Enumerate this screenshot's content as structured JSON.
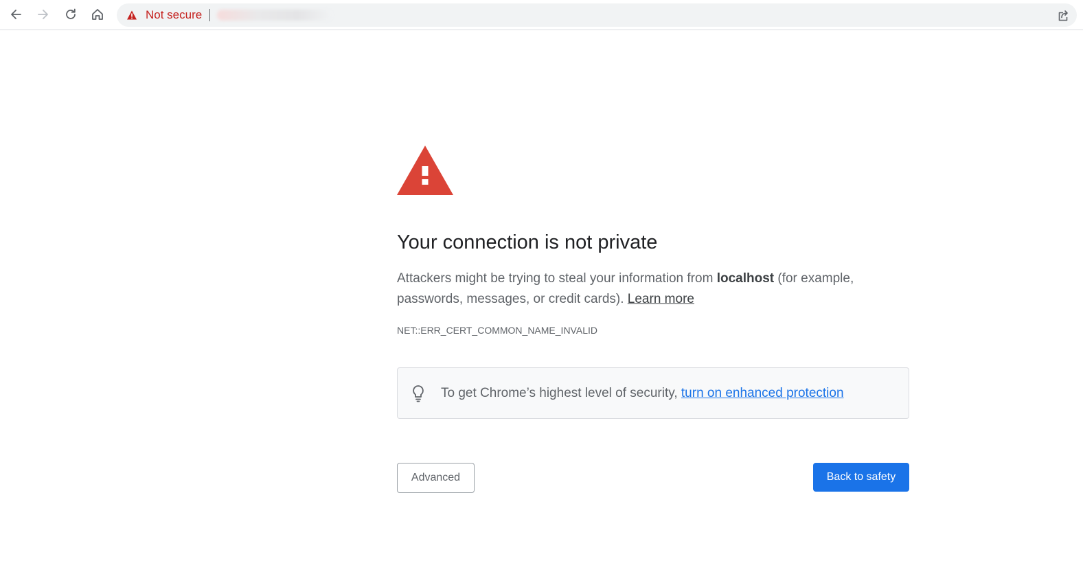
{
  "browser": {
    "security_status": "Not secure",
    "icons": {
      "back": "back-arrow-icon",
      "forward": "forward-arrow-icon",
      "reload": "reload-icon",
      "home": "home-icon",
      "warning": "warning-triangle-icon",
      "share": "share-icon"
    }
  },
  "page": {
    "title": "Your connection is not private",
    "message_before": "Attackers might be trying to steal your information from ",
    "host": "localhost",
    "message_after": " (for example, passwords, messages, or credit cards). ",
    "learn_more": "Learn more",
    "error_code": "NET::ERR_CERT_COMMON_NAME_INVALID",
    "promo_text": "To get Chrome’s highest level of security, ",
    "promo_link": "turn on enhanced protection",
    "advanced_label": "Advanced",
    "back_label": "Back to safety"
  },
  "colors": {
    "danger": "#db4437",
    "link": "#1a73e8",
    "primary_button": "#1a73e8",
    "status_red": "#c5221f"
  }
}
